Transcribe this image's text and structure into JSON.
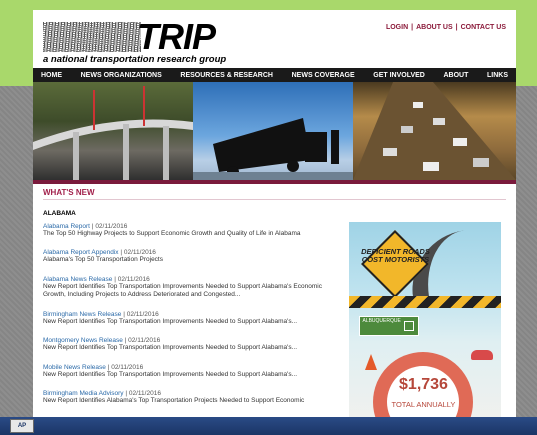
{
  "logo": {
    "word": "TRIP",
    "tagline": "a national transportation research group"
  },
  "top_links": [
    {
      "label": "LOGIN"
    },
    {
      "label": "ABOUT US"
    },
    {
      "label": "CONTACT US"
    }
  ],
  "nav": [
    {
      "label": "HOME"
    },
    {
      "label": "NEWS ORGANIZATIONS"
    },
    {
      "label": "RESOURCES & RESEARCH"
    },
    {
      "label": "NEWS COVERAGE"
    },
    {
      "label": "GET INVOLVED"
    },
    {
      "label": "ABOUT"
    },
    {
      "label": "LINKS"
    }
  ],
  "whats_new": "WHAT'S NEW",
  "section": "ALABAMA",
  "news": [
    {
      "title": "Alabama Report",
      "date": "02/11/2016",
      "summary": "The Top 50 Highway Projects to Support Economic Growth and Quality of Life in Alabama"
    },
    {
      "title": "Alabama Report Appendix",
      "date": "02/11/2016",
      "summary": "Alabama's Top 50 Transportation Projects"
    },
    {
      "title": "Alabama News Release",
      "date": "02/11/2016",
      "summary": "New Report Identifies Top Transportation Improvements Needed to Support Alabama's Economic Growth, Including Projects to Address Deteriorated and Congested..."
    },
    {
      "title": "Birmingham News Release",
      "date": "02/11/2016",
      "summary": "New Report Identifies Top Transportation Improvements Needed to Support Alabama's..."
    },
    {
      "title": "Montgomery News Release",
      "date": "02/11/2016",
      "summary": "New Report Identifies Top Transportation Improvements Needed to Support Alabama's..."
    },
    {
      "title": "Mobile News Release",
      "date": "02/11/2016",
      "summary": "New Report Identifies Top Transportation Improvements Needed to Support Alabama's..."
    },
    {
      "title": "Birmingham Media Advisory",
      "date": "02/11/2016",
      "summary": "New Report Identifies Alabama's Top Transportation Projects Needed to Support Economic"
    }
  ],
  "ad": {
    "sign_text": "DEFICIENT ROADS COST MOTORISTS",
    "city_sign": "ALBUQUERQUE",
    "amount": "$1,736",
    "total_label": "TOTAL ANNUALLY"
  },
  "taskbar": {
    "start_label": "AP"
  }
}
